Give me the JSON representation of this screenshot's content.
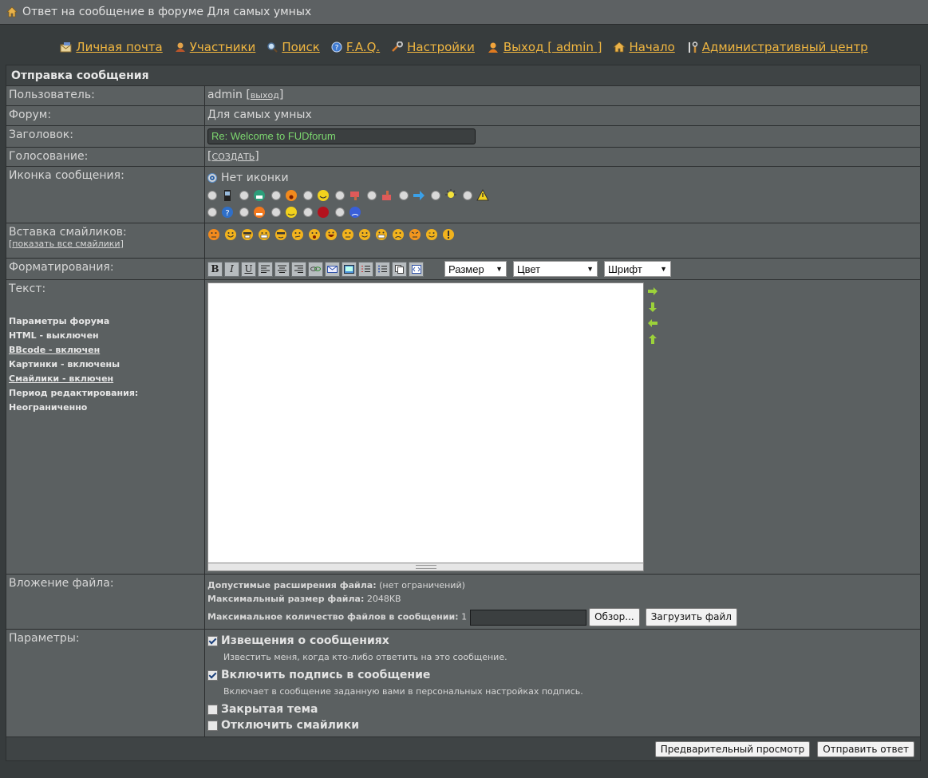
{
  "window": {
    "title": "Ответ на сообщение в форуме Для самых умных"
  },
  "nav": [
    {
      "label": "Личная почта",
      "icon": "mail-icon"
    },
    {
      "label": "Участники",
      "icon": "members-icon"
    },
    {
      "label": "Поиск",
      "icon": "search-icon"
    },
    {
      "label": "F.A.Q.",
      "icon": "help-icon"
    },
    {
      "label": "Настройки",
      "icon": "wrench-icon"
    },
    {
      "label": "Выход [ admin ]",
      "icon": "user-icon"
    },
    {
      "label": "Начало",
      "icon": "home-icon"
    },
    {
      "label": "Административный центр",
      "icon": "admin-tools-icon"
    }
  ],
  "form": {
    "header": "Отправка сообщения",
    "user_label": "Пользователь:",
    "user_value": "admin",
    "logout_link": "выход",
    "forum_label": "Форум:",
    "forum_value": "Для самых умных",
    "subject_label": "Заголовок:",
    "subject_value": "Re: Welcome to FUDforum",
    "poll_label": "Голосование:",
    "poll_link": "СОЗДАТЬ",
    "icon_label": "Иконка сообщения:",
    "no_icon_label": "Нет иконки",
    "smilies_label": "Вставка смайликов:",
    "show_all_smilies": "показать все смайлики",
    "format_label": "Форматирования:",
    "size_select": "Размер",
    "color_select": "Цвет",
    "font_select": "Шрифт",
    "text_label": "Текст:",
    "params_title": "Параметры форума",
    "html_status": "HTML - выключен",
    "bbcode_status": "BBcode - включен",
    "images_status": "Картинки - включены",
    "smilies_status": "Смайлики - включен",
    "edit_period": "Период редактирования: Неограниченно",
    "attach_label": "Вложение файла:",
    "allowed_ext_label": "Допустимые расширения файла:",
    "allowed_ext_value": "(нет ограничений)",
    "max_size_label": "Максимальный размер файла:",
    "max_size_value": "2048KB",
    "max_files_label": "Максимальное количество файлов в сообщении:",
    "max_files_value": "1",
    "browse_button": "Обзор...",
    "upload_button": "Загрузить файл",
    "options_label": "Параметры:",
    "opt_notify": "Извещения о сообщениях",
    "opt_notify_desc": "Известить меня, когда кто-либо ответить на это сообщение.",
    "opt_signature": "Включить подпись в сообщение",
    "opt_signature_desc": "Включает в сообщение заданную вами в персональных настройках подпись.",
    "opt_locked": "Закрытая тема",
    "opt_nosmilies": "Отключить смайлики",
    "preview_button": "Предварительный просмотр",
    "submit_button": "Отправить ответ"
  },
  "colors": {
    "link": "#f0b640",
    "panel": "#5b6061",
    "background": "#373c3d",
    "subject_text": "#7cd66f"
  }
}
